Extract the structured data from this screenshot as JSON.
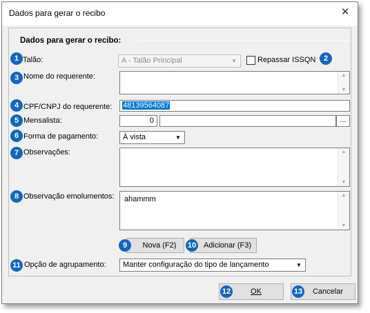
{
  "window": {
    "title": "Dados para gerar o recibo",
    "close_icon": "close-icon"
  },
  "section": {
    "title": "Dados para gerar o recibo:"
  },
  "badges": [
    "1",
    "2",
    "3",
    "4",
    "5",
    "6",
    "7",
    "8",
    "9",
    "10",
    "11",
    "12",
    "13"
  ],
  "talao": {
    "label": "Talão:",
    "value": "A - Talão Principal"
  },
  "repassar": {
    "label": "Repassar ISSQN",
    "checked": false
  },
  "nome": {
    "label": "Nome do requerente:",
    "value": ""
  },
  "cpf": {
    "label": "CPF/CNPJ do requerente:",
    "value": "48139564087"
  },
  "mensalista": {
    "label": "Mensalista:",
    "code": "0",
    "name": "",
    "browse": "..."
  },
  "pagamento": {
    "label": "Forma de pagamento:",
    "value": "À vista"
  },
  "observacoes": {
    "label": "Observações:",
    "value": ""
  },
  "emolumentos": {
    "label": "Observação emolumentos:",
    "value": "ahammm"
  },
  "buttons": {
    "nova": "Nova (F2)",
    "adicionar": "Adicionar (F3)",
    "ok": "OK",
    "cancelar": "Cancelar"
  },
  "agrupamento": {
    "label": "Opção de agrupamento:",
    "value": "Manter configuração do tipo de lançamento"
  },
  "colors": {
    "badge": "#1565c0",
    "selection": "#0078d7"
  }
}
